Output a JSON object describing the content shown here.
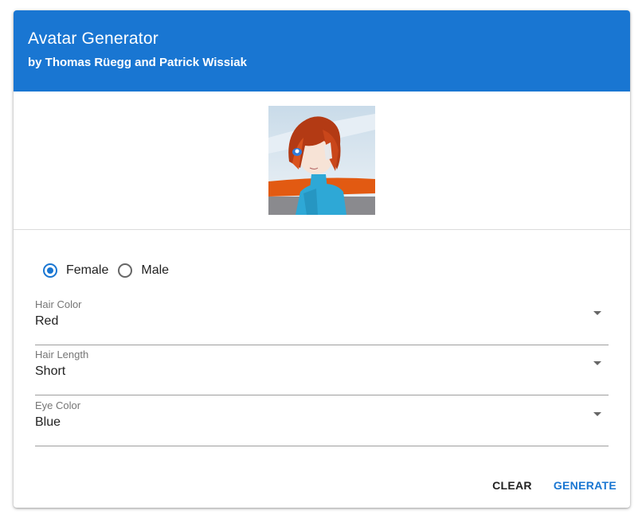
{
  "header": {
    "title": "Avatar Generator",
    "subtitle": "by Thomas Rüegg and Patrick Wissiak"
  },
  "avatar": {
    "description_icon": "generated-avatar-image"
  },
  "gender": {
    "options": [
      {
        "label": "Female",
        "checked": true
      },
      {
        "label": "Male",
        "checked": false
      }
    ]
  },
  "fields": {
    "hair_color": {
      "label": "Hair Color",
      "value": "Red"
    },
    "hair_length": {
      "label": "Hair Length",
      "value": "Short"
    },
    "eye_color": {
      "label": "Eye Color",
      "value": "Blue"
    }
  },
  "actions": {
    "clear": "CLEAR",
    "generate": "GENERATE"
  },
  "colors": {
    "primary": "#1976d2",
    "text": "#222222",
    "muted": "#757575"
  }
}
